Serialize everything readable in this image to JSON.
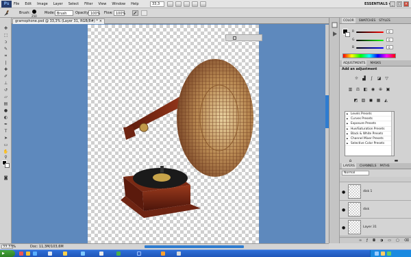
{
  "app": {
    "logo": "Ps",
    "workspace": "ESSENTIALS ▾"
  },
  "menu": {
    "items": [
      "File",
      "Edit",
      "Image",
      "Layer",
      "Select",
      "Filter",
      "View",
      "Window",
      "Help"
    ],
    "zoom": "33,3"
  },
  "options": {
    "brush_label": "Brush:",
    "brush_size": "250",
    "mode_label": "Mode:",
    "mode_value": "Brush",
    "opacity_label": "Opacity:",
    "opacity_value": "100%",
    "flow_label": "Flow:",
    "flow_value": "100%"
  },
  "document": {
    "tab_title": "gramophone.psd @ 33,3% (Layer 31, RGB/8#) *",
    "zoom_value": "33,33%",
    "doc_info": "Doc: 11,3M/103,6M"
  },
  "color_panel": {
    "tabs": [
      "COLOR",
      "SWATCHES",
      "STYLES"
    ],
    "channels": [
      {
        "label": "R",
        "value": "0"
      },
      {
        "label": "G",
        "value": "0"
      },
      {
        "label": "B",
        "value": "0"
      }
    ]
  },
  "adjustments_panel": {
    "tabs": [
      "ADJUSTMENTS",
      "MASKS"
    ],
    "heading": "Add an adjustment",
    "presets": [
      "Levels Presets",
      "Curves Presets",
      "Exposure Presets",
      "Hue/Saturation Presets",
      "Black & White Presets",
      "Channel Mixer Presets",
      "Selective Color Presets"
    ]
  },
  "layers_panel": {
    "tabs": [
      "LAYERS",
      "CHANNELS",
      "PATHS"
    ],
    "blend_mode": "Normal",
    "layers": [
      {
        "name": "disk 1"
      },
      {
        "name": "disk"
      },
      {
        "name": "Layer 31"
      }
    ]
  },
  "colors": {
    "canvas_bg": "#5e89bd",
    "accent": "#2e7cd0"
  }
}
